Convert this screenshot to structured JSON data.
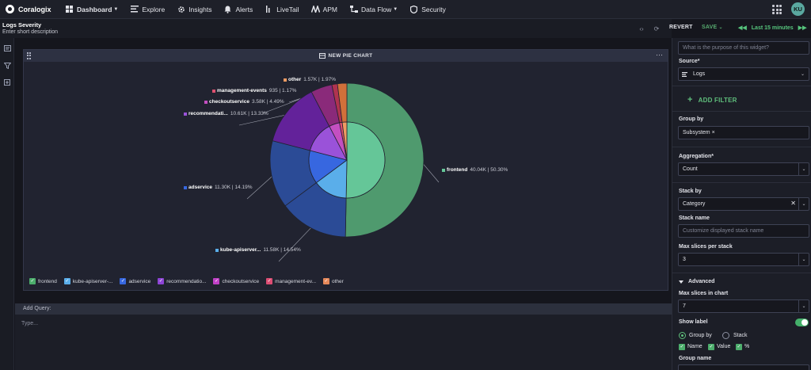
{
  "nav": {
    "brand": "Coralogix",
    "items": [
      {
        "label": "Dashboard",
        "icon": "grid-icon",
        "active": true,
        "dropdown": true
      },
      {
        "label": "Explore",
        "icon": "list-icon"
      },
      {
        "label": "Insights",
        "icon": "gear-icon"
      },
      {
        "label": "Alerts",
        "icon": "bell-icon"
      },
      {
        "label": "LiveTail",
        "icon": "bars-icon"
      },
      {
        "label": "APM",
        "icon": "apm-icon"
      },
      {
        "label": "Data Flow",
        "icon": "flow-icon",
        "dropdown": true
      },
      {
        "label": "Security",
        "icon": "shield-icon"
      }
    ],
    "avatar": "KU"
  },
  "header": {
    "title": "Logs Severity",
    "description": "Enter short description",
    "revert": "REVERT",
    "save": "SAVE",
    "time_range": "Last 15 minutes"
  },
  "widget": {
    "title": "NEW PIE CHART"
  },
  "chart_data": {
    "type": "pie",
    "categories": [
      "frontend",
      "kube-apiserver-...",
      "adservice",
      "recommendatio...",
      "checkoutservice",
      "management-ev...",
      "other"
    ],
    "slice_labels": [
      "frontend",
      "kube-apiserver...",
      "adservice",
      "recommendati...",
      "checkoutservice",
      "management-events",
      "other"
    ],
    "value_labels": [
      "40.04K",
      "11.58K",
      "11.30K",
      "10.61K",
      "3.58K",
      "935",
      "1.57K"
    ],
    "percent_labels": [
      "50.30%",
      "14.54%",
      "14.19%",
      "13.33%",
      "4.49%",
      "1.17%",
      "1.97%"
    ],
    "percents": [
      50.3,
      14.54,
      14.19,
      13.33,
      4.49,
      1.17,
      1.97
    ],
    "colors": [
      "#4f9a6e",
      "#2b4b96",
      "#2b4b96",
      "#63229a",
      "#8a2a7a",
      "#b0334f",
      "#d1703a"
    ],
    "inner_colors": [
      "#65c698",
      "#5aaeea",
      "#3767e0",
      "#9a52d9",
      "#c44fc1",
      "#df4f6f",
      "#ef9b62"
    ],
    "legend_colors": [
      "#4cae6c",
      "#5aaeea",
      "#3767e0",
      "#8e44d6",
      "#c140c7",
      "#dd4d73",
      "#e6895a"
    ],
    "legend": "bottom-left"
  },
  "query": {
    "header": "Add Query:",
    "placeholder": "Type..."
  },
  "panel": {
    "purpose_placeholder": "What is the purpose of this widget?",
    "source_label": "Source*",
    "source_value": "Logs",
    "add_filter": "ADD FILTER",
    "group_by_label": "Group by",
    "group_by_value": "Subsystem ×",
    "aggregation_label": "Aggregation*",
    "aggregation_value": "Count",
    "stack_by_label": "Stack by",
    "stack_by_value": "Category",
    "stack_name_label": "Stack name",
    "stack_name_placeholder": "Customize displayed stack name",
    "max_slices_stack_label": "Max slices per stack",
    "max_slices_stack_value": "3",
    "advanced_label": "Advanced",
    "max_slices_chart_label": "Max slices in chart",
    "max_slices_chart_value": "7",
    "show_label": "Show label",
    "radio_group_by": "Group by",
    "radio_stack": "Stack",
    "check_name": "Name",
    "check_value": "Value",
    "check_percent": "%",
    "group_name_label": "Group name"
  }
}
